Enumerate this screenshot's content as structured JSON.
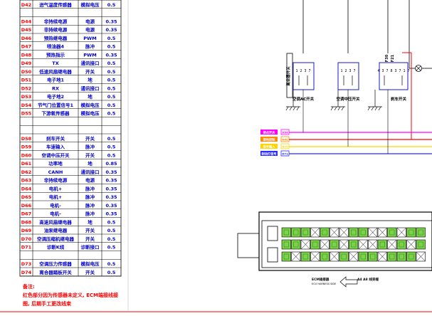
{
  "pin_table": {
    "rows": [
      {
        "pin": "D42",
        "name": "进气温度传感器",
        "type": "模拟电压",
        "val": "0.5",
        "sep": false
      },
      {
        "pin": "",
        "name": "",
        "type": "",
        "val": "",
        "sep": true
      },
      {
        "pin": "D44",
        "name": "非持续电源",
        "type": "电源",
        "val": "0.35",
        "sep": false
      },
      {
        "pin": "D45",
        "name": "非持续电源",
        "type": "电源",
        "val": "0.35",
        "sep": false
      },
      {
        "pin": "D46",
        "name": "预热继电器",
        "type": "PWM",
        "val": "0.5",
        "sep": false
      },
      {
        "pin": "D47",
        "name": "喷油器4",
        "type": "脉冲",
        "val": "0.5",
        "sep": false
      },
      {
        "pin": "D48",
        "name": "预热指示",
        "type": "PWM",
        "val": "0.35",
        "sep": false
      },
      {
        "pin": "D49",
        "name": "TX",
        "type": "通讯接口",
        "val": "0.5",
        "sep": false
      },
      {
        "pin": "D50",
        "name": "低速风扇继电器",
        "type": "开关",
        "val": "0.5",
        "sep": false
      },
      {
        "pin": "D51",
        "name": "电子地1",
        "type": "地",
        "val": "0.5",
        "sep": false
      },
      {
        "pin": "D52",
        "name": "RX",
        "type": "通讯接口",
        "val": "0.5",
        "sep": false
      },
      {
        "pin": "D53",
        "name": "电子地2",
        "type": "地",
        "val": "0.5",
        "sep": false
      },
      {
        "pin": "D54",
        "name": "节气门位置信号1",
        "type": "模拟电压",
        "val": "0.5",
        "sep": false
      },
      {
        "pin": "D55",
        "name": "下游氧传感器",
        "type": "模拟电压",
        "val": "0.5",
        "sep": false
      },
      {
        "pin": "",
        "name": "",
        "type": "",
        "val": "",
        "sep": true
      },
      {
        "pin": "",
        "name": "",
        "type": "",
        "val": "",
        "sep": true
      },
      {
        "pin": "D58",
        "name": "刹车开关",
        "type": "开关",
        "val": "0.5",
        "sep": false
      },
      {
        "pin": "D59",
        "name": "车速输入",
        "type": "脉冲",
        "val": "0.5",
        "sep": false
      },
      {
        "pin": "D60",
        "name": "空调中压开关",
        "type": "开关",
        "val": "0.5",
        "sep": false
      },
      {
        "pin": "D61",
        "name": "功率地",
        "type": "地",
        "val": "0.85",
        "sep": false
      },
      {
        "pin": "D62",
        "name": "CANH",
        "type": "通讯接口",
        "val": "0.35",
        "sep": false
      },
      {
        "pin": "D63",
        "name": "非持续电源",
        "type": "电源",
        "val": "0.35",
        "sep": false
      },
      {
        "pin": "D64",
        "name": "电机+",
        "type": "脉冲",
        "val": "0.35",
        "sep": false
      },
      {
        "pin": "D65",
        "name": "电机+",
        "type": "脉冲",
        "val": "0.35",
        "sep": false
      },
      {
        "pin": "D66",
        "name": "电机-",
        "type": "脉冲",
        "val": "0.35",
        "sep": false
      },
      {
        "pin": "D67",
        "name": "电机-",
        "type": "脉冲",
        "val": "0.35",
        "sep": false
      },
      {
        "pin": "D68",
        "name": "高速风扇继电器",
        "type": "地",
        "val": "0.5",
        "sep": false
      },
      {
        "pin": "D69",
        "name": "油泵继电器",
        "type": "开关",
        "val": "0.5",
        "sep": false
      },
      {
        "pin": "D70",
        "name": "空调压缩机继电器",
        "type": "开关",
        "val": "0.5",
        "sep": false
      },
      {
        "pin": "D71",
        "name": "诊断K线",
        "type": "诊断接口",
        "val": "0.5",
        "sep": false
      },
      {
        "pin": "",
        "name": "",
        "type": "",
        "val": "",
        "sep": true
      },
      {
        "pin": "D73",
        "name": "空调压力传感器",
        "type": "模拟电压",
        "val": "0.5",
        "sep": false
      },
      {
        "pin": "D74",
        "name": "离合器踏板开关",
        "type": "开关",
        "val": "0.5",
        "sep": false
      }
    ]
  },
  "notes": {
    "title": "备注:",
    "line1": "红色部分因为传感器未定义, ECM端接线接",
    "line2": "图, 后期手工更改线束"
  },
  "switches": {
    "sw1_label": "空调AC开关",
    "sw2_label": "空调中压开关",
    "sw3_label": "刹车开关",
    "side_label": "离合器开关",
    "pins_sw1": "1 2 3 7",
    "pins_sw2": "1 2 3 7",
    "pins_sw3": "4 3 7 8  3 7 1 7",
    "top_tags": [
      "F30",
      "F21"
    ]
  },
  "legend": {
    "tags": [
      "接点开关",
      "接地控制",
      "信号输入",
      "制动灯信号"
    ],
    "pins": [
      "D58",
      "D60",
      "D70",
      "D71"
    ]
  },
  "connector": {
    "caption_left": "ECM插接器",
    "caption_sub": "ECU HARNESS SIDE",
    "caption_right": "A4 A8 线束端",
    "arrow_label": "⇦",
    "cavity_rows": 3,
    "cavity_cols": 16
  },
  "colors": {
    "wire_red": "#ff0000",
    "wire_magenta": "#ff00ff",
    "wire_yellow": "#ffd400",
    "wire_blue": "#2a2aff",
    "wire_orange": "#ff8a00",
    "cavity_green": "#7cd34a",
    "table_text": "#0000c8"
  }
}
